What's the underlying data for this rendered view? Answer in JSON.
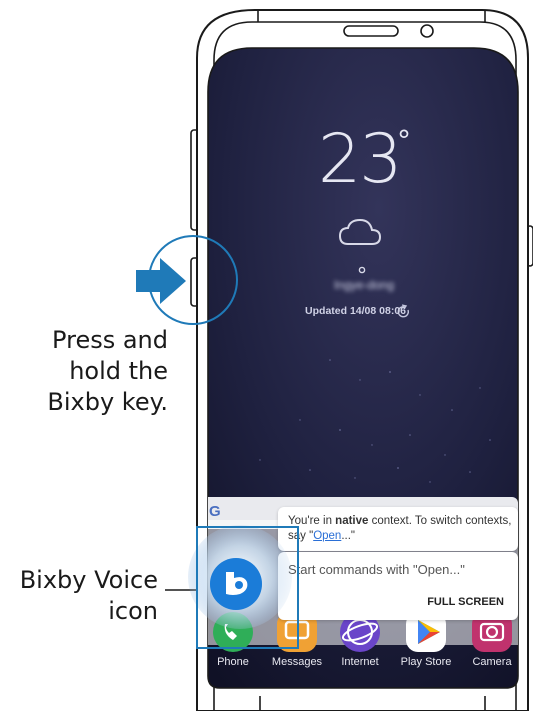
{
  "callouts": {
    "bixby_key": [
      "Press and",
      "hold the",
      "Bixby key."
    ],
    "voice_icon": [
      "Bixby Voice",
      "icon"
    ]
  },
  "lockscreen": {
    "temperature": "23",
    "degree_symbol": "°",
    "weather_icon": "cloud-icon",
    "location": "Ingye-dong",
    "updated": "Updated 14/08 08:06",
    "refresh_icon": "refresh-icon"
  },
  "bixby_dialog": {
    "message_prefix": "You're in ",
    "message_bold": "native",
    "message_suffix": " context. To switch contexts,",
    "message_line2_prefix": "say \"",
    "message_link": "Open",
    "message_line2_suffix": "...\"",
    "prompt": "Start commands with \"Open...\"",
    "full_screen_label": "FULL SCREEN"
  },
  "search_bar": {
    "logo": "G"
  },
  "dock": {
    "apps": [
      {
        "label": "Phone",
        "icon": "phone-icon"
      },
      {
        "label": "Messages",
        "icon": "messages-icon"
      },
      {
        "label": "Internet",
        "icon": "internet-icon"
      },
      {
        "label": "Play Store",
        "icon": "play-store-icon"
      },
      {
        "label": "Camera",
        "icon": "camera-icon"
      }
    ]
  },
  "colors": {
    "arrow": "#1f7ab8",
    "highlight_box": "#1f7ab8",
    "link": "#2a6fd6",
    "bixby_blue": "#1b7cd8"
  }
}
